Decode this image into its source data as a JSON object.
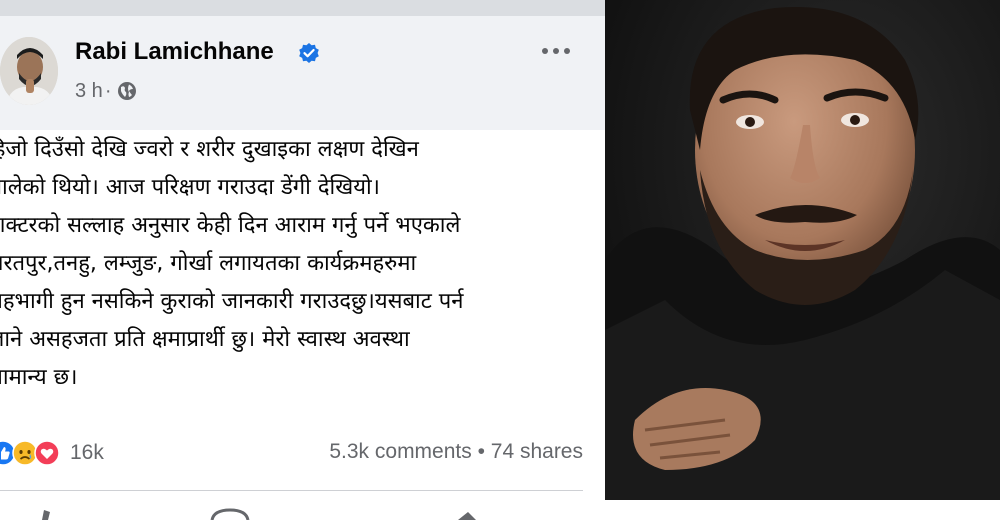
{
  "post": {
    "author": "Rabi Lamichhane",
    "time": "3 h",
    "separator": "·",
    "body": "हिजो दिउँसो देखि ज्वरो र शरीर दुखाइका लक्षण देखिन\nथालेको थियो। आज परिक्षण गराउदा डेंगी देखियो।\nडाक्टरको सल्लाह अनुसार केही दिन आराम गर्नु पर्ने भएकाले\nभरतपुर,तनहु, लम्जुङ, गोर्खा लगायतका कार्यक्रमहरुमा\nसहभागी हुन नसकिने कुराको जानकारी गराउदछु।यसबाट पर्न\nजाने असहजता प्रति क्षमाप्रार्थी छु। मेरो स्वास्थ अवस्था\nसामान्य छ।",
    "reaction_count": "16k",
    "stats": "5.3k comments • 74 shares"
  },
  "icons": {
    "verified": "verified-badge-icon",
    "globe": "globe-icon",
    "more": "more-options-icon",
    "reactions": [
      "like-reaction-icon",
      "sad-reaction-icon",
      "love-reaction-icon"
    ]
  },
  "colors": {
    "text": "#050505",
    "secondary_text": "#65676b",
    "verified_blue": "#1b74e4",
    "header_bg": "#f0f2f5",
    "like_blue": "#1877f2",
    "love_red": "#f33e58",
    "sad_yellow": "#f7b928"
  }
}
